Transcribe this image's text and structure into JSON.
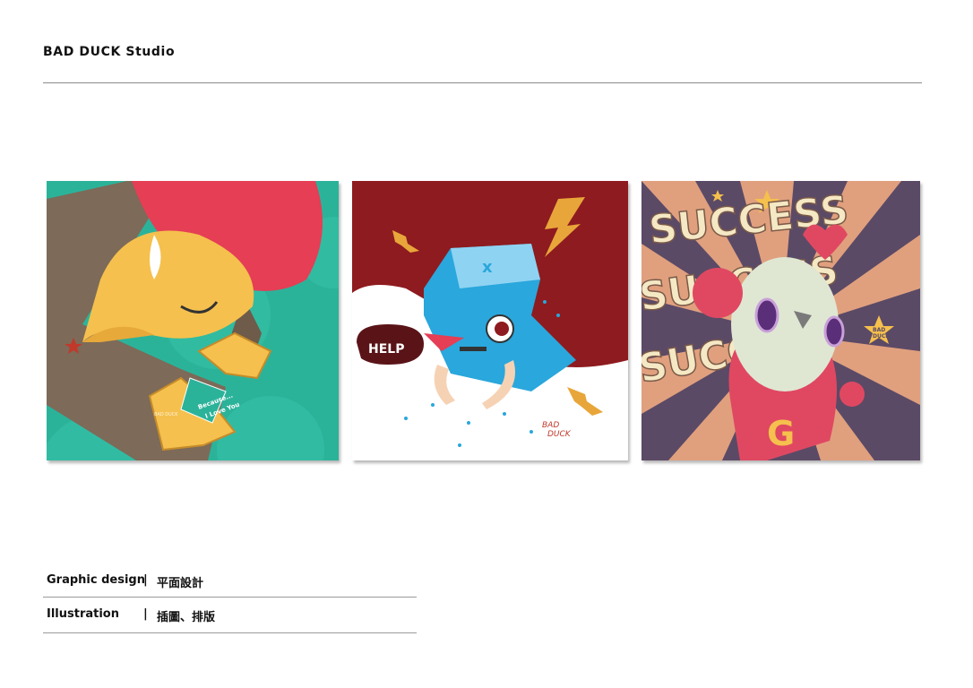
{
  "header": {
    "title": "BAD DUCK Studio"
  },
  "gallery": {
    "items": [
      {
        "speech_line1": "Because...",
        "speech_line2": "I Love You",
        "signature": "BAD DUCK"
      },
      {
        "speech": "HELP",
        "signature_line1": "BAD",
        "signature_line2": "DUCK"
      },
      {
        "word": "SUCCESS",
        "badge_line1": "BAD",
        "badge_line2": "DUCK",
        "emblem": "G"
      }
    ]
  },
  "info": {
    "rows": [
      {
        "label": "Graphic design",
        "separator": "|",
        "value": "平面設計"
      },
      {
        "label": "Illustration",
        "separator": "|",
        "value": "插圖、排版"
      }
    ]
  },
  "colors": {
    "teal": "#2bb39a",
    "red": "#8e1b1f",
    "blue": "#2aa7dc",
    "gold": "#e8a63a",
    "cream": "#f5e8c4",
    "purple": "#5b4a66"
  }
}
